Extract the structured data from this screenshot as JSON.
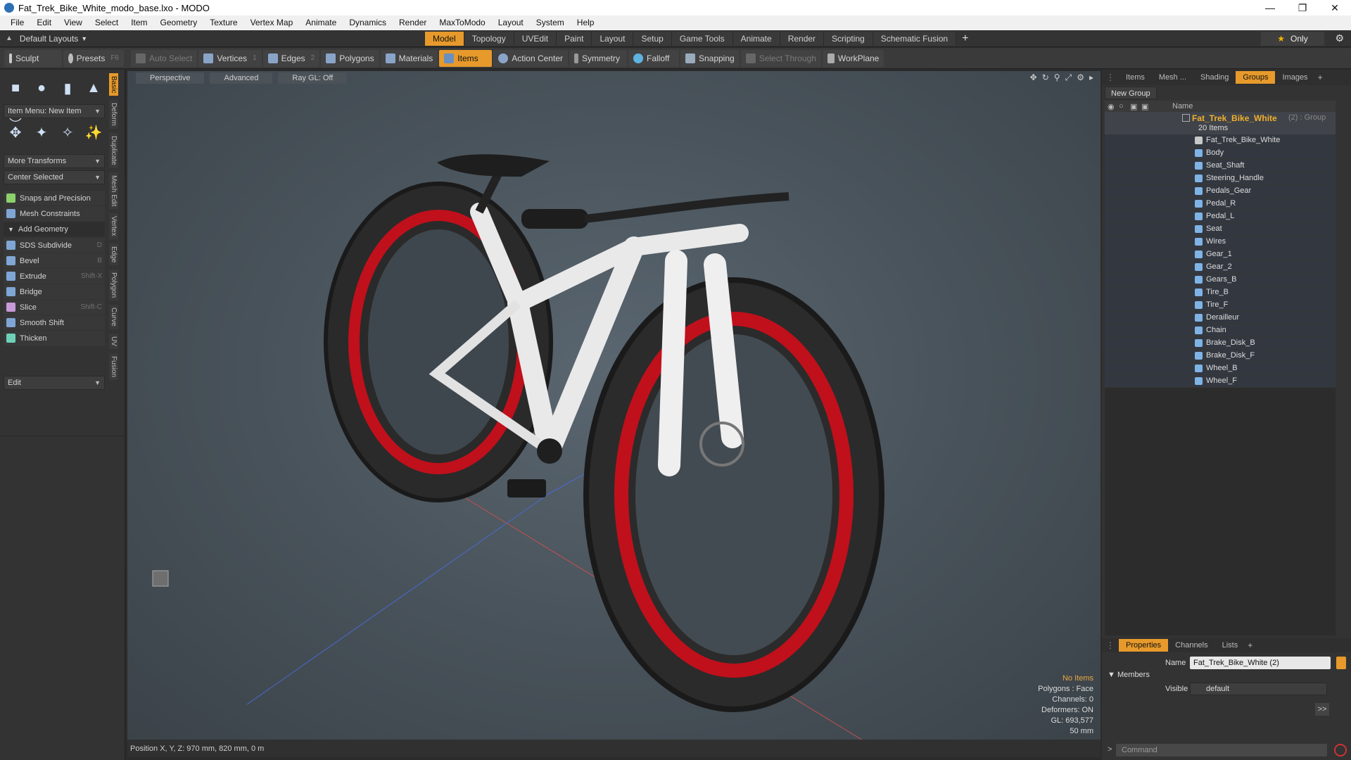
{
  "window": {
    "title": "Fat_Trek_Bike_White_modo_base.lxo - MODO"
  },
  "menu": [
    "File",
    "Edit",
    "View",
    "Select",
    "Item",
    "Geometry",
    "Texture",
    "Vertex Map",
    "Animate",
    "Dynamics",
    "Render",
    "MaxToModo",
    "Layout",
    "System",
    "Help"
  ],
  "layout": {
    "preset": "Default Layouts",
    "tabs": [
      "Model",
      "Topology",
      "UVEdit",
      "Paint",
      "Layout",
      "Setup",
      "Game Tools",
      "Animate",
      "Render",
      "Scripting",
      "Schematic Fusion"
    ],
    "active_tab": "Model",
    "only_label": "Only"
  },
  "toolbar": {
    "sculpt": "Sculpt",
    "presets": "Presets",
    "presets_key": "F6",
    "auto_select": "Auto Select",
    "vertices": "Vertices",
    "vertices_key": "1",
    "edges": "Edges",
    "edges_key": "2",
    "polygons": "Polygons",
    "materials": "Materials",
    "items": "Items",
    "action_center": "Action Center",
    "symmetry": "Symmetry",
    "falloff": "Falloff",
    "snapping": "Snapping",
    "select_through": "Select Through",
    "workplane": "WorkPlane"
  },
  "left_panel": {
    "item_menu": "Item Menu: New Item",
    "more_transforms": "More Transforms",
    "center_selected": "Center Selected",
    "snaps": "Snaps and Precision",
    "mesh_constraints": "Mesh Constraints",
    "add_geometry": "Add Geometry",
    "tools": [
      {
        "label": "SDS Subdivide",
        "key": "D"
      },
      {
        "label": "Bevel",
        "key": "B"
      },
      {
        "label": "Extrude",
        "key": "Shift-X"
      },
      {
        "label": "Bridge",
        "key": ""
      },
      {
        "label": "Slice",
        "key": "Shift-C"
      },
      {
        "label": "Smooth Shift",
        "key": ""
      },
      {
        "label": "Thicken",
        "key": ""
      }
    ],
    "edit": "Edit",
    "vertical_tabs": [
      "Basic",
      "Deform",
      "Duplicate",
      "Mesh Edit",
      "Vertex",
      "Edge",
      "Polygon",
      "Curve",
      "UV",
      "Fusion"
    ]
  },
  "viewport": {
    "tabs": [
      "Perspective",
      "Advanced",
      "Ray GL: Off"
    ],
    "info": {
      "selection": "No Items",
      "polygons": "Polygons : Face",
      "channels": "Channels: 0",
      "deformers": "Deformers: ON",
      "gl": "GL: 693,577",
      "scale": "50 mm"
    }
  },
  "status": {
    "position": "Position X, Y, Z:  970 mm, 820 mm, 0 m"
  },
  "right_panel": {
    "tabs": [
      "Items",
      "Mesh ...",
      "Shading",
      "Groups",
      "Images"
    ],
    "active_tab": "Groups",
    "new_group": "New Group",
    "name_col": "Name",
    "group_name": "Fat_Trek_Bike_White",
    "group_suffix": "(2) : Group",
    "group_count": "20 Items",
    "items": [
      "Fat_Trek_Bike_White",
      "Body",
      "Seat_Shaft",
      "Steering_Handle",
      "Pedals_Gear",
      "Pedal_R",
      "Pedal_L",
      "Seat",
      "Wires",
      "Gear_1",
      "Gear_2",
      "Gears_B",
      "Tire_B",
      "Tire_F",
      "Derailleur",
      "Chain",
      "Brake_Disk_B",
      "Brake_Disk_F",
      "Wheel_B",
      "Wheel_F"
    ]
  },
  "properties": {
    "tabs": [
      "Properties",
      "Channels",
      "Lists"
    ],
    "active_tab": "Properties",
    "name_label": "Name",
    "name_value": "Fat_Trek_Bike_White (2)",
    "members": "Members",
    "visible_label": "Visible",
    "visible_value": "default",
    "command_placeholder": "Command"
  },
  "colors": {
    "accent": "#e79a2b",
    "group_text": "#f2b02e",
    "rim_red": "#c0101b"
  }
}
